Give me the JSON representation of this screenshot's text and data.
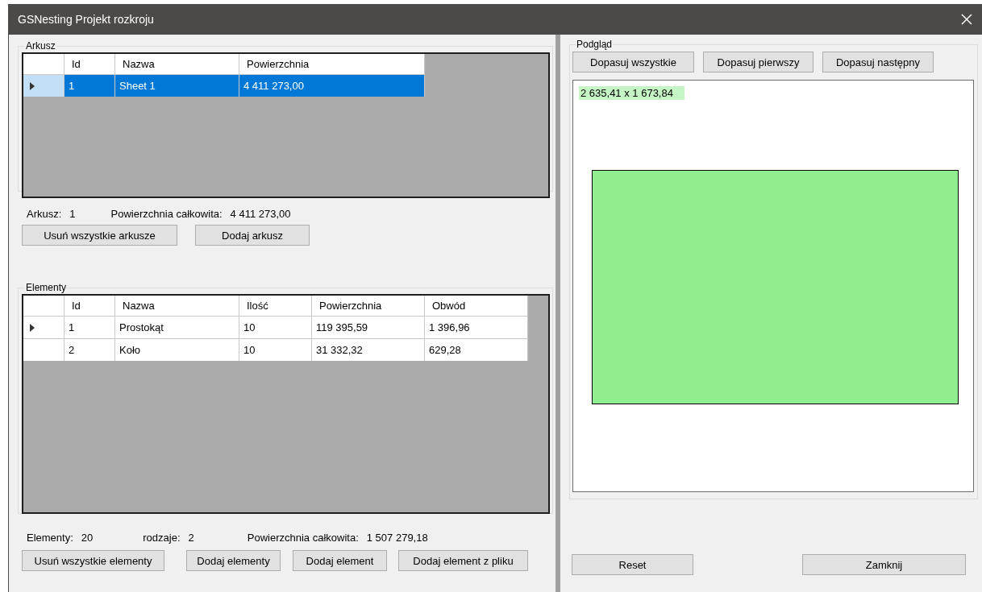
{
  "window": {
    "title": "GSNesting Projekt rozkroju"
  },
  "sheets": {
    "title": "Arkusz",
    "columns": [
      "Id",
      "Nazwa",
      "Powierzchnia"
    ],
    "rows": [
      {
        "cells": [
          "1",
          "Sheet 1",
          "4 411 273,00"
        ],
        "selected": true,
        "current": true
      }
    ],
    "summary": [
      {
        "label": "Arkusz:",
        "value": "1"
      },
      {
        "label": "Powierzchnia całkowita:",
        "value": "4 411 273,00"
      }
    ],
    "buttons": [
      "Usuń wszystkie arkusze",
      "Dodaj arkusz"
    ]
  },
  "elements": {
    "title": "Elementy",
    "columns": [
      "Id",
      "Nazwa",
      "Ilość",
      "Powierzchnia",
      "Obwód"
    ],
    "rows": [
      {
        "cells": [
          "1",
          "Prostokąt",
          "10",
          "119 395,59",
          "1 396,96"
        ],
        "selected": false,
        "current": true
      },
      {
        "cells": [
          "2",
          "Koło",
          "10",
          "31 332,32",
          "629,28"
        ],
        "selected": false,
        "current": false
      }
    ],
    "summary": [
      {
        "label": "Elementy:",
        "value": "20"
      },
      {
        "label": "rodzaje:",
        "value": "2"
      },
      {
        "label": "Powierzchnia całkowita:",
        "value": "1 507 279,18"
      }
    ],
    "buttons": [
      "Usuń wszystkie elementy",
      "Dodaj elementy",
      "Dodaj element",
      "Dodaj element z pliku"
    ]
  },
  "preview": {
    "title": "Podgląd",
    "buttons": [
      "Dopasuj wszystkie",
      "Dopasuj pierwszy",
      "Dopasuj następny"
    ],
    "dimensions": "2 635,41 x 1 673,84"
  },
  "footer_buttons": [
    "Reset",
    "Zamknij"
  ]
}
